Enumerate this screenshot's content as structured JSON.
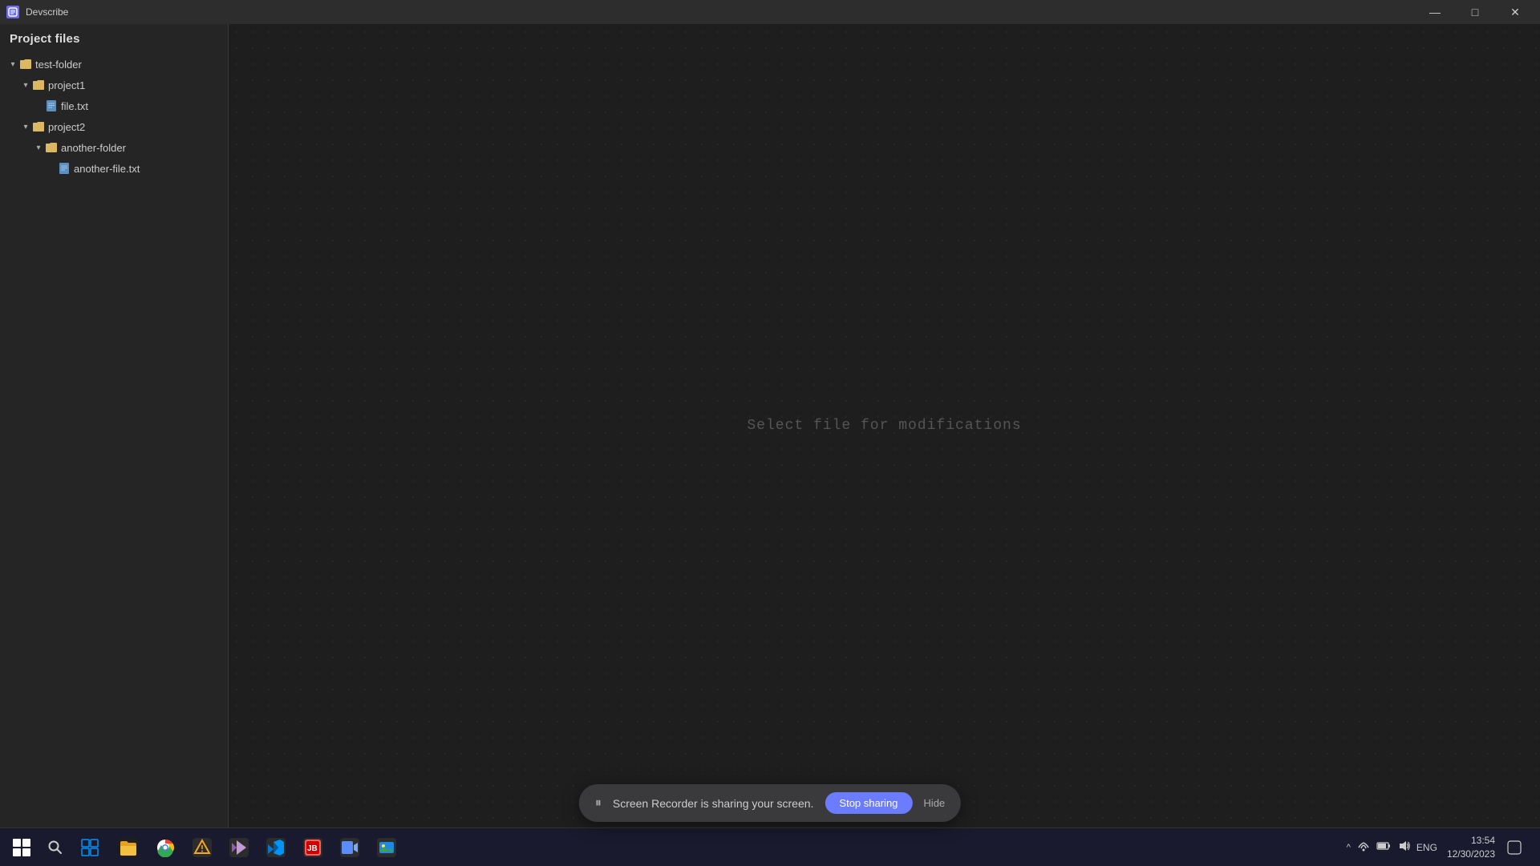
{
  "titleBar": {
    "appName": "Devscribe",
    "minimizeLabel": "—",
    "maximizeLabel": "□",
    "closeLabel": "✕"
  },
  "sidebar": {
    "header": "Project files",
    "tree": [
      {
        "id": "test-folder",
        "label": "test-folder",
        "type": "folder",
        "level": 0,
        "expanded": true
      },
      {
        "id": "project1",
        "label": "project1",
        "type": "folder",
        "level": 1,
        "expanded": true
      },
      {
        "id": "file-txt",
        "label": "file.txt",
        "type": "file",
        "level": 2,
        "expanded": false
      },
      {
        "id": "project2",
        "label": "project2",
        "type": "folder",
        "level": 1,
        "expanded": true
      },
      {
        "id": "another-folder",
        "label": "another-folder",
        "type": "folder",
        "level": 2,
        "expanded": true
      },
      {
        "id": "another-file-txt",
        "label": "another-file.txt",
        "type": "file",
        "level": 3,
        "expanded": false
      }
    ]
  },
  "editor": {
    "placeholder": "Select file for modifications"
  },
  "screenShare": {
    "message": "Screen Recorder is sharing your screen.",
    "stopButton": "Stop sharing",
    "hideButton": "Hide"
  },
  "taskbar": {
    "apps": [
      {
        "id": "start",
        "label": "Start",
        "color": "#fff"
      },
      {
        "id": "search",
        "label": "Search",
        "color": "#fff"
      },
      {
        "id": "task-view",
        "label": "Task View",
        "color": "#0078d4"
      },
      {
        "id": "explorer",
        "label": "File Explorer",
        "color": "#e8a020"
      },
      {
        "id": "chrome",
        "label": "Chrome",
        "color": "#4caf50"
      },
      {
        "id": "sketch",
        "label": "Sketch",
        "color": "#f5a623"
      },
      {
        "id": "vs",
        "label": "Visual Studio",
        "color": "#9b59b6"
      },
      {
        "id": "vscode",
        "label": "VS Code",
        "color": "#0078d4"
      },
      {
        "id": "jetbrains",
        "label": "JetBrains",
        "color": "#ff5c5c"
      },
      {
        "id": "screen-recorder",
        "label": "Screen Recorder",
        "color": "#5b8dff"
      },
      {
        "id": "photos",
        "label": "Photos",
        "color": "#0078d4"
      }
    ],
    "tray": {
      "chevron": "^",
      "lang": "ENG",
      "time": "13:54",
      "date": "12/30/2023"
    }
  }
}
